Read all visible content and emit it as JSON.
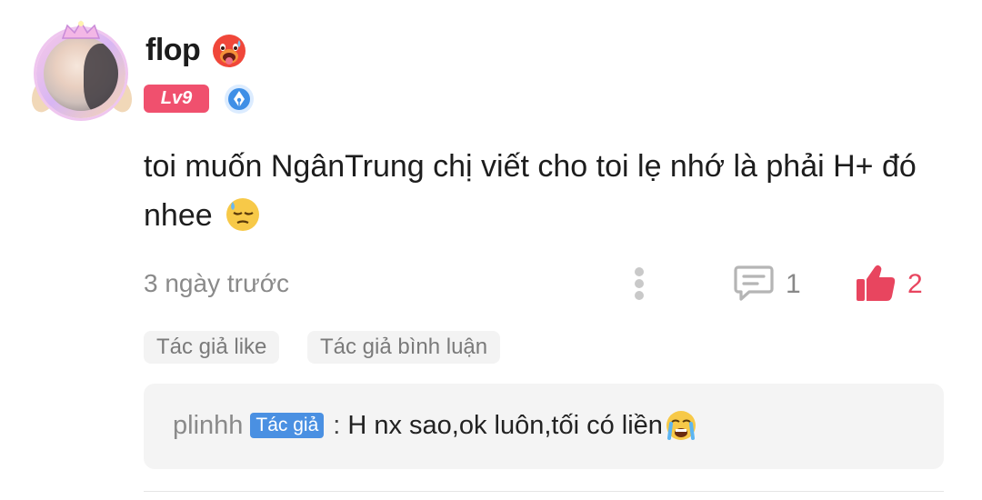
{
  "comment": {
    "username": "flop",
    "level": "Lv9",
    "text": "toi muốn NgânTrung chị viết cho toi lẹ nhớ là phải H+ đó nhee",
    "time": "3 ngày trước",
    "reply_count": "1",
    "like_count": "2",
    "tags": [
      "Tác giả like",
      "Tác giả bình luận"
    ]
  },
  "reply": {
    "username": "plinhh",
    "badge": "Tác giả",
    "separator": ":",
    "text": "H nx sao,ok luôn,tối có liền"
  },
  "icons": {
    "user_emoji": "hot-face-emoji",
    "pen_badge": "pen-badge-icon",
    "comment_emoji": "downcast-sweat-emoji",
    "more": "more-vertical-icon",
    "reply": "comment-icon",
    "like": "thumbs-up-icon",
    "reply_emoji": "crying-face-emoji"
  },
  "colors": {
    "level_badge": "#f0506e",
    "like": "#e8455f",
    "author_badge": "#4a90e2",
    "muted": "#8a8a8a"
  }
}
